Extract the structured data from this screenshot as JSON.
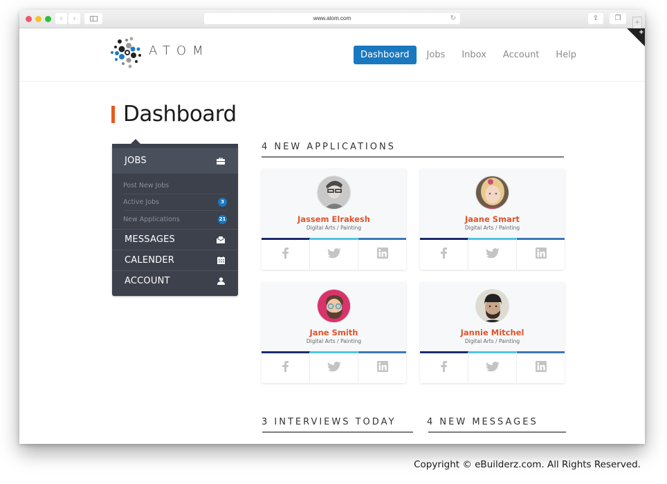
{
  "browser": {
    "url": "www.atom.com"
  },
  "brand": {
    "name": "ATOM",
    "accent": "#1a78bf",
    "highlight": "#e85b1d"
  },
  "nav": {
    "items": [
      {
        "label": "Dashboard",
        "active": true
      },
      {
        "label": "Jobs",
        "active": false
      },
      {
        "label": "Inbox",
        "active": false
      },
      {
        "label": "Account",
        "active": false
      },
      {
        "label": "Help",
        "active": false
      }
    ]
  },
  "page": {
    "title": "Dashboard"
  },
  "sidebar": {
    "jobs": {
      "label": "JOBS",
      "icon": "briefcase-icon",
      "subitems": [
        {
          "label": "Post New Jobs",
          "badge": null
        },
        {
          "label": "Active Jobs",
          "badge": "3"
        },
        {
          "label": "New Applications",
          "badge": "21"
        }
      ]
    },
    "items": [
      {
        "label": "MESSAGES",
        "icon": "envelope-icon"
      },
      {
        "label": "CALENDER",
        "icon": "calendar-icon"
      },
      {
        "label": "ACCOUNT",
        "icon": "user-icon"
      }
    ]
  },
  "applications": {
    "title": "4 NEW APPLICATIONS",
    "cards": [
      {
        "name": "Jassem Elrakesh",
        "role": "Digital Arts / Painting"
      },
      {
        "name": "Jaane Smart",
        "role": "Digital Arts / Painting"
      },
      {
        "name": "Jane Smith",
        "role": "Digital Arts / Painting"
      },
      {
        "name": "Jannie Mitchel",
        "role": "Digital Arts / Painting"
      }
    ],
    "social": [
      "facebook-icon",
      "twitter-icon",
      "linkedin-icon"
    ]
  },
  "interviews": {
    "title": "3 INTERVIEWS TODAY"
  },
  "messages": {
    "title": "4 NEW MESSAGES"
  },
  "footer": {
    "copyright": "Copyright © eBuilderz.com. All Rights Reserved."
  }
}
